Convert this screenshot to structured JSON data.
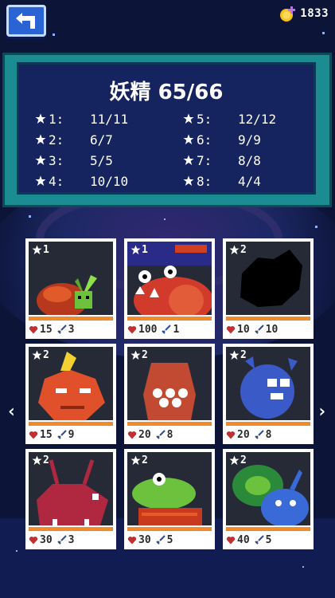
{
  "header": {
    "back_icon": "back-arrow-icon",
    "coin_icon": "coin-plus-icon",
    "coin_count": "1833"
  },
  "collection": {
    "title": "妖精 65/66",
    "star_rows": [
      {
        "label": "1:",
        "value": "11/11"
      },
      {
        "label": "2:",
        "value": "6/7"
      },
      {
        "label": "3:",
        "value": "5/5"
      },
      {
        "label": "4:",
        "value": "10/10"
      },
      {
        "label": "5:",
        "value": "12/12"
      },
      {
        "label": "6:",
        "value": "9/9"
      },
      {
        "label": "7:",
        "value": "8/8"
      },
      {
        "label": "8:",
        "value": "4/4"
      }
    ]
  },
  "cards": [
    {
      "stars": "1",
      "hp": "15",
      "atk": "3",
      "locked": false
    },
    {
      "stars": "1",
      "hp": "100",
      "atk": "1",
      "locked": false
    },
    {
      "stars": "2",
      "hp": "10",
      "atk": "10",
      "locked": true
    },
    {
      "stars": "2",
      "hp": "15",
      "atk": "9",
      "locked": false
    },
    {
      "stars": "2",
      "hp": "20",
      "atk": "8",
      "locked": false
    },
    {
      "stars": "2",
      "hp": "20",
      "atk": "8",
      "locked": false
    },
    {
      "stars": "2",
      "hp": "30",
      "atk": "3",
      "locked": false
    },
    {
      "stars": "2",
      "hp": "30",
      "atk": "5",
      "locked": false
    },
    {
      "stars": "2",
      "hp": "40",
      "atk": "5",
      "locked": false
    }
  ],
  "nav": {
    "prev": "‹",
    "next": "›"
  },
  "colors": {
    "panel_frame": "#1b8c92",
    "panel_fill": "#15235e",
    "card_stripe": "#f08a2a",
    "back_button": "#2a63d4"
  }
}
